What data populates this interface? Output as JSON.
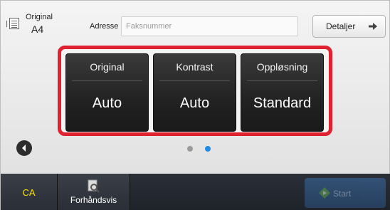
{
  "header": {
    "original_label": "Original",
    "original_size": "A4",
    "address_label": "Adresse",
    "address_placeholder": "Faksnummer",
    "address_value": "",
    "details_button": "Detaljer"
  },
  "cards": [
    {
      "title": "Original",
      "value": "Auto"
    },
    {
      "title": "Kontrast",
      "value": "Auto"
    },
    {
      "title": "Oppløsning",
      "value": "Standard"
    }
  ],
  "pager": {
    "page_count": 2,
    "current_page": 2
  },
  "footer": {
    "ca_button": "CA",
    "preview_button": "Forhåndsvis",
    "start_button": "Start"
  },
  "colors": {
    "highlight_border": "#e0212f",
    "ca_text": "#ffe000",
    "active_dot": "#1e8de8",
    "start_button": "#3b6fa8"
  },
  "icons": {
    "original": "original-document-icon",
    "details_arrow": "arrow-right-icon",
    "back": "back-arrow-icon",
    "preview": "preview-magnifier-icon",
    "start": "start-diamond-icon"
  }
}
